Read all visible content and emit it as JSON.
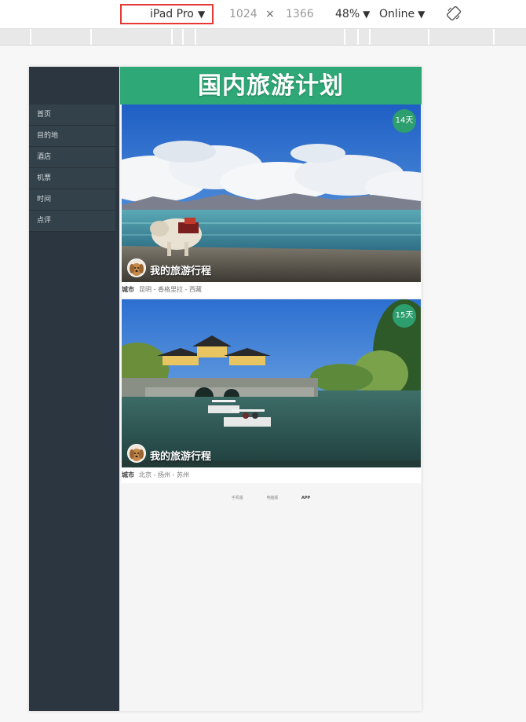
{
  "toolbar": {
    "device": "iPad Pro",
    "width": "1024",
    "times": "×",
    "height": "1366",
    "zoom": "48%",
    "network": "Online",
    "caret": "▼"
  },
  "sidebar": {
    "items": [
      {
        "label": "首页"
      },
      {
        "label": "目的地"
      },
      {
        "label": "酒店"
      },
      {
        "label": "机票"
      },
      {
        "label": "时间"
      },
      {
        "label": "点评"
      }
    ]
  },
  "header": {
    "title": "国内旅游计划"
  },
  "cards": [
    {
      "days": "14天",
      "name": "我的旅游行程",
      "city_label": "城市",
      "route": "昆明 - 香格里拉 - 西藏"
    },
    {
      "days": "15天",
      "name": "我的旅游行程",
      "city_label": "城市",
      "route": "北京 - 扬州 - 苏州"
    }
  ],
  "footer": {
    "links": [
      "手机版",
      "电脑版",
      "APP"
    ]
  },
  "colors": {
    "accent_green": "#2fa877",
    "sidebar_bg": "#2b3640",
    "highlight_red": "#e53935"
  }
}
